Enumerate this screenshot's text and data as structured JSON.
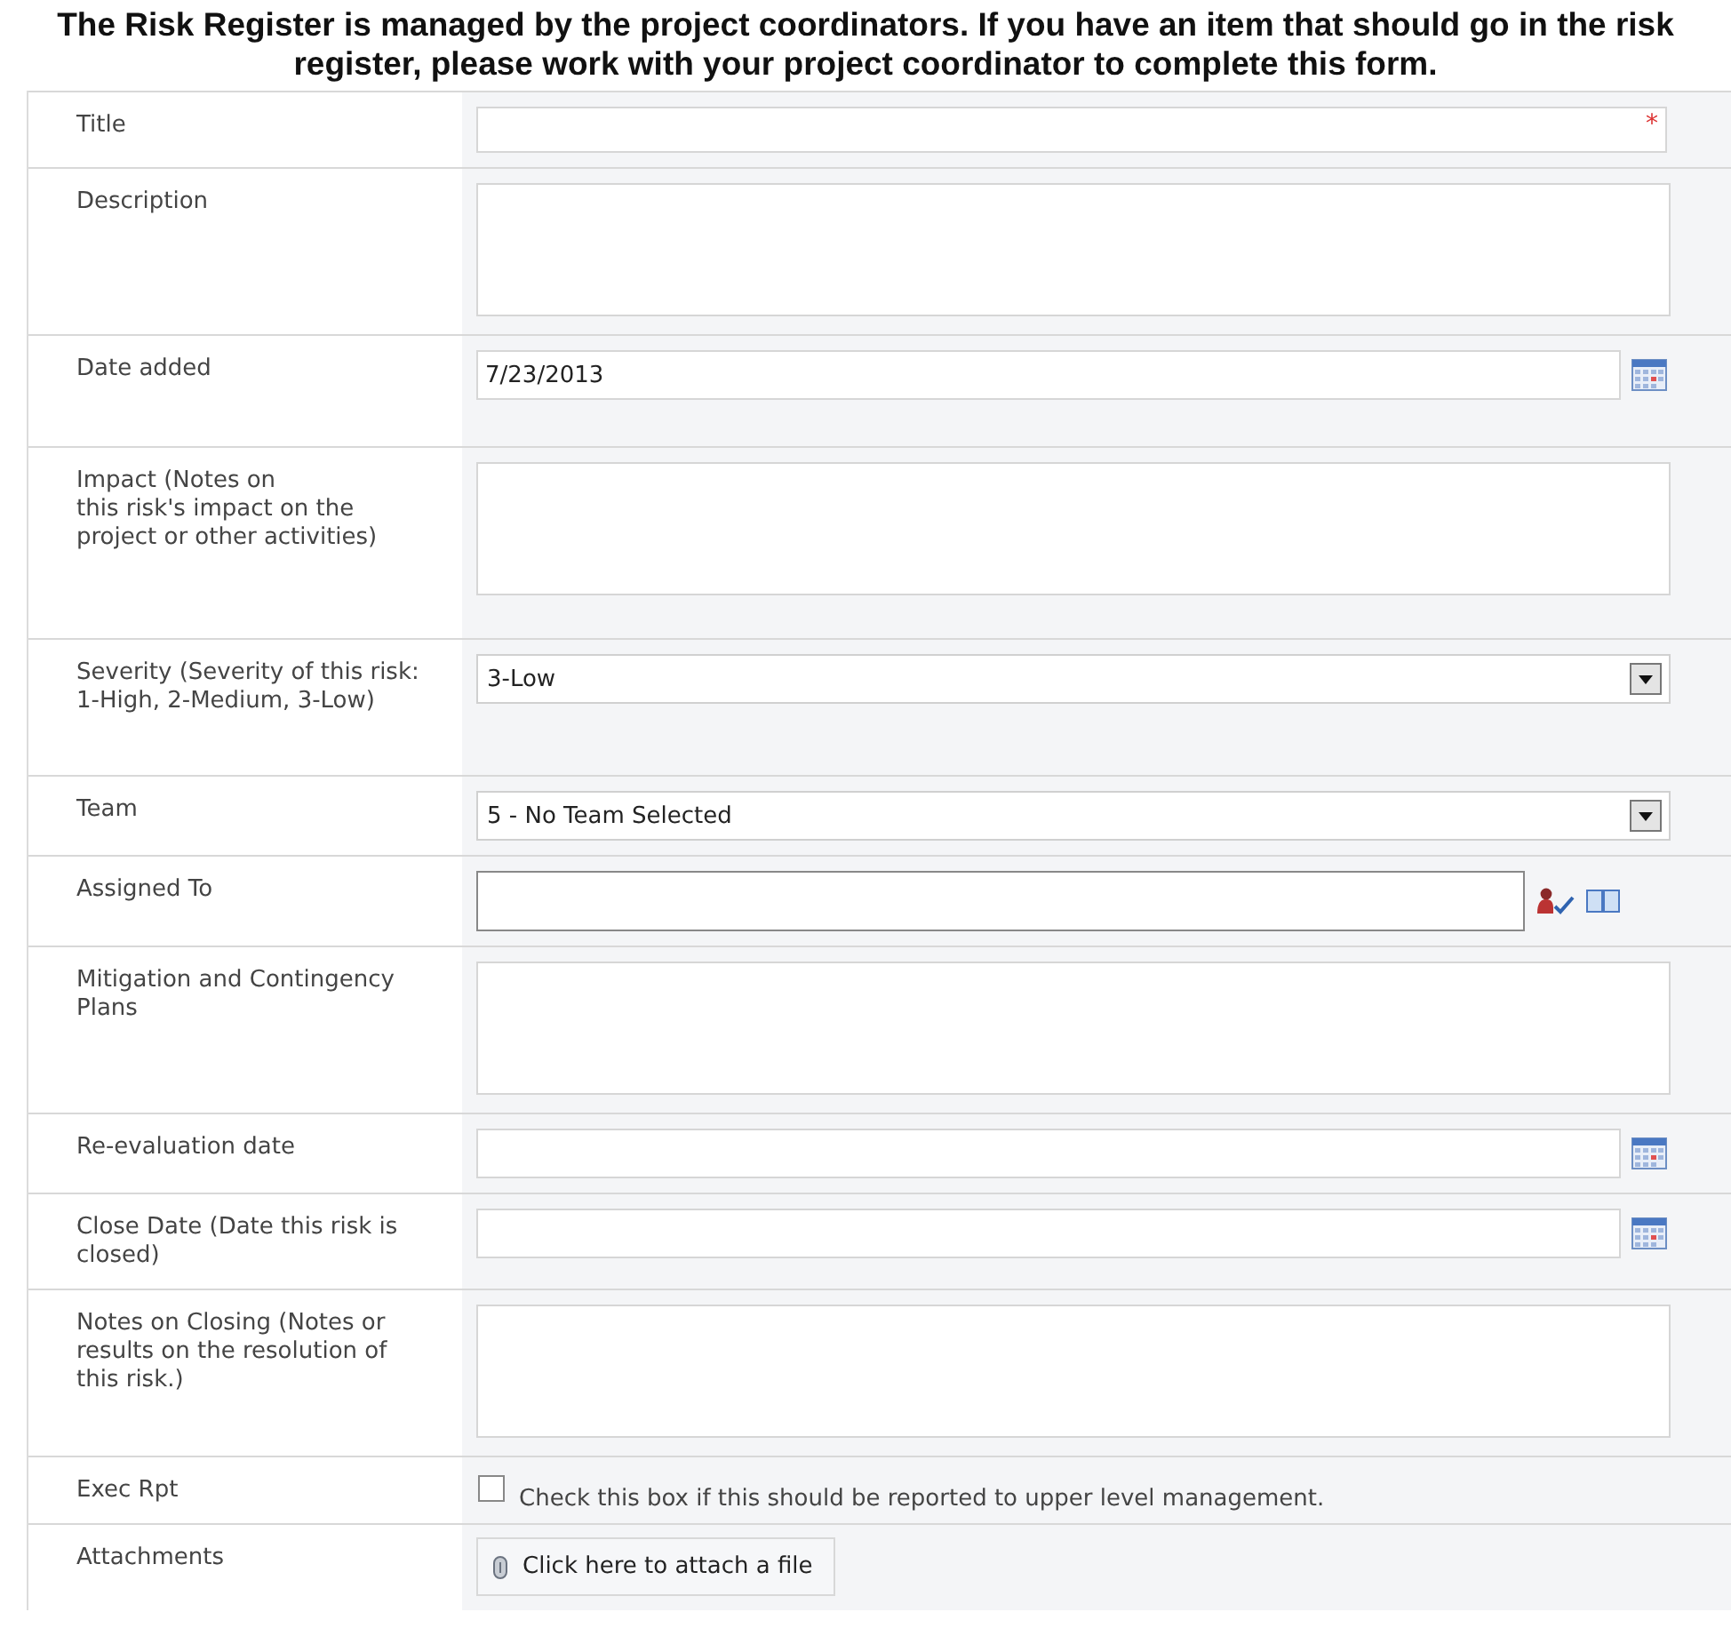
{
  "intro": "The Risk Register is managed by the project coordinators. If you have an item that should go in the risk register, please work with your project coordinator to complete this form.",
  "fields": [
    {
      "kind": "text",
      "label": "Title",
      "required_mark": "*"
    },
    {
      "kind": "textarea",
      "label": "Description"
    },
    {
      "kind": "date",
      "label": "Date added",
      "value": "7/23/2013"
    },
    {
      "kind": "textarea",
      "label": "Impact (Notes on\nthis risk's impact on the project or other activities)"
    },
    {
      "kind": "select",
      "label": "Severity (Severity of this risk: 1-High, 2-Medium, 3-Low)",
      "value": "3-Low"
    },
    {
      "kind": "select",
      "label": "Team",
      "value": "5 - No Team Selected"
    },
    {
      "kind": "people",
      "label": "Assigned To"
    },
    {
      "kind": "textarea",
      "label": "Mitigation and Contingency Plans"
    },
    {
      "kind": "date",
      "label": "Re-evaluation date"
    },
    {
      "kind": "date",
      "label": "Close Date (Date this risk is closed)"
    },
    {
      "kind": "textarea",
      "label": "Notes on Closing (Notes or results on the resolution of this risk.)"
    },
    {
      "kind": "checkbox",
      "label": "Exec Rpt",
      "checked": false,
      "text": "Check this box if this should be reported to upper level management."
    },
    {
      "kind": "attachment",
      "label": "Attachments",
      "text": "Click here to attach a file"
    }
  ]
}
